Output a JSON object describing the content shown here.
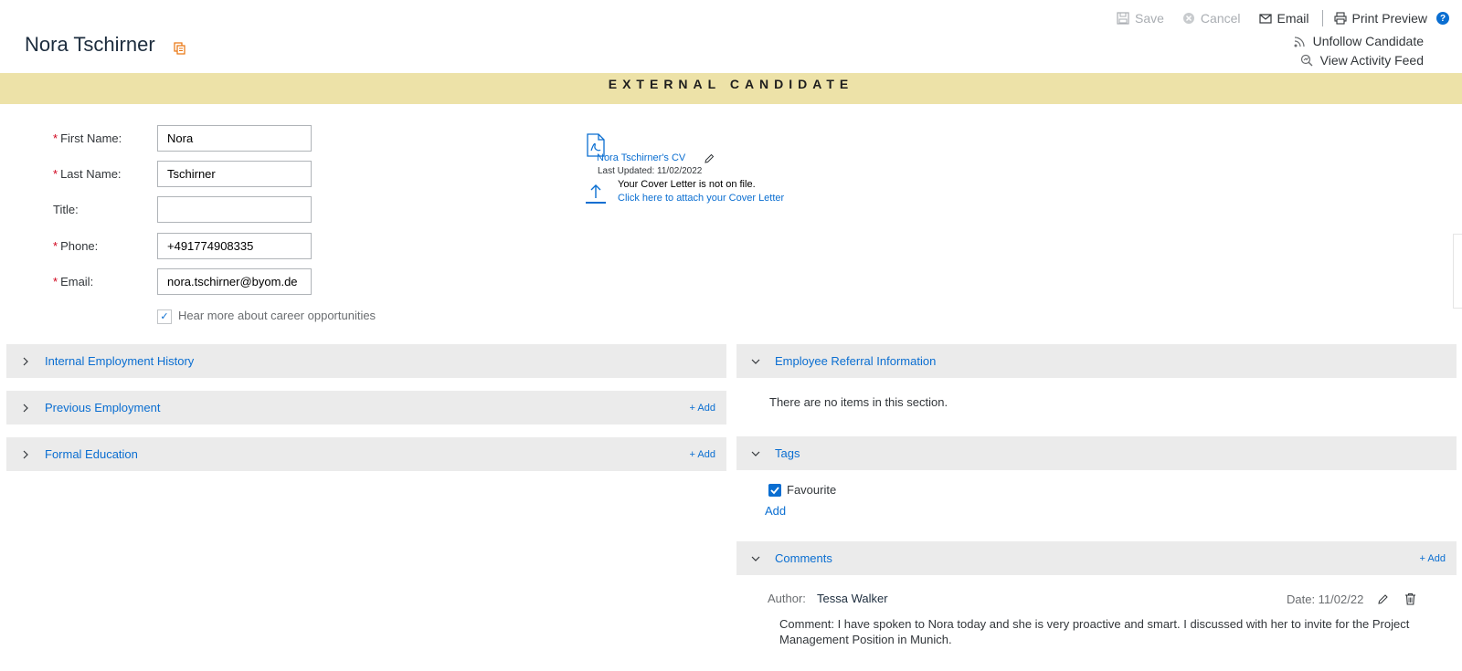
{
  "header": {
    "candidate_name": "Nora Tschirner",
    "banner": "EXTERNAL CANDIDATE"
  },
  "toolbar": {
    "save": "Save",
    "cancel": "Cancel",
    "email": "Email",
    "print_preview": "Print Preview",
    "unfollow": "Unfollow Candidate",
    "activity_feed": "View Activity Feed"
  },
  "form": {
    "first_name_label": "First Name:",
    "first_name_value": "Nora",
    "last_name_label": "Last Name:",
    "last_name_value": "Tschirner",
    "title_label": "Title:",
    "title_value": "",
    "phone_label": "Phone:",
    "phone_value": "+491774908335",
    "email_label": "Email:",
    "email_value": "nora.tschirner@byom.de",
    "career_opt_label": "Hear more about career opportunities",
    "career_opt_checked": true
  },
  "attachments": {
    "cv_link": "Nora Tschirner's CV",
    "cv_updated": "Last Updated: 11/02/2022",
    "cover_note": "Your Cover Letter is not on file.",
    "cover_link": "Click here to attach your Cover Letter"
  },
  "sections_left": [
    {
      "title": "Internal Employment History",
      "add": ""
    },
    {
      "title": "Previous Employment",
      "add": "+ Add"
    },
    {
      "title": "Formal Education",
      "add": "+ Add"
    }
  ],
  "referral": {
    "title": "Employee Referral Information",
    "empty_text": "There are no items in this section."
  },
  "tags": {
    "title": "Tags",
    "items": [
      {
        "label": "Favourite",
        "checked": true
      }
    ],
    "add": "Add"
  },
  "comments": {
    "title": "Comments",
    "add": "+ Add",
    "author_label": "Author:",
    "author_name": "Tessa Walker",
    "date": "Date: 11/02/22",
    "text": "Comment: I have spoken to Nora today and she is very proactive and smart. I discussed with her to invite for the Project Management Position in Munich."
  },
  "colors": {
    "accent": "#0a6ed1",
    "banner": "#ede2a8",
    "panel": "#ebebeb",
    "required": "#d0021b"
  }
}
